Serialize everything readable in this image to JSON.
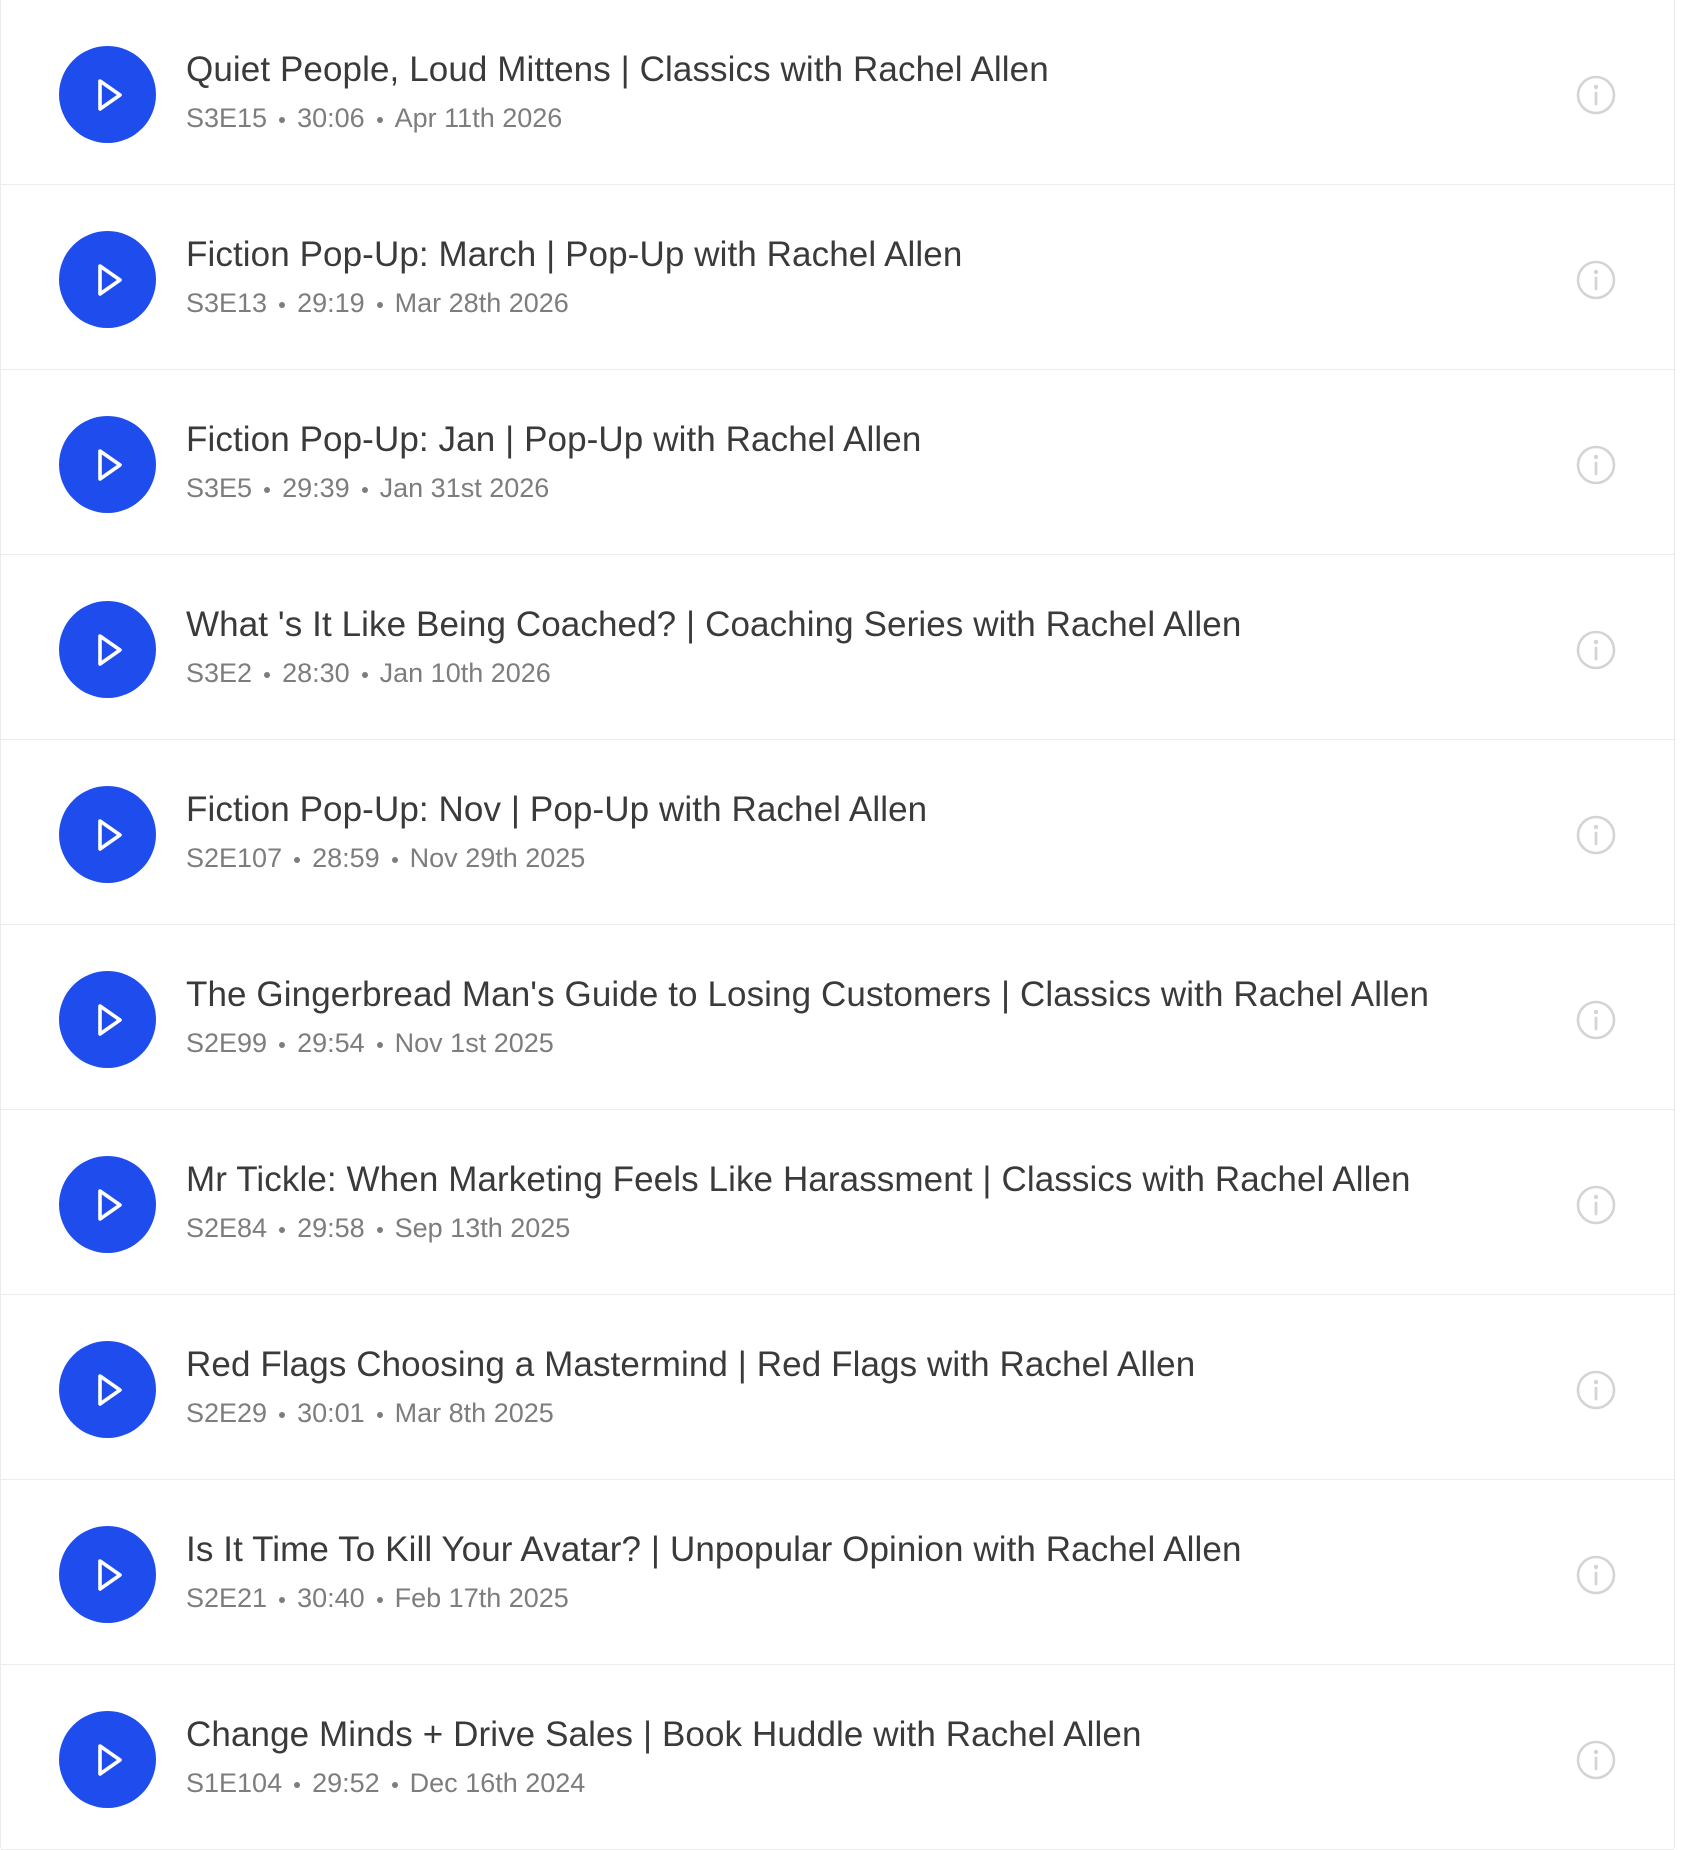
{
  "colors": {
    "play_button": "#1f4ded",
    "title_text": "#3a3a3a",
    "meta_text": "#7d7d7d",
    "info_icon": "#d4d4d4",
    "divider": "#ececec"
  },
  "episodes": [
    {
      "title": "Quiet People, Loud Mittens | Classics with Rachel Allen",
      "code": "S3E15",
      "duration": "30:06",
      "date": "Apr 11th 2026"
    },
    {
      "title": "Fiction Pop-Up: March | Pop-Up with Rachel Allen",
      "code": "S3E13",
      "duration": "29:19",
      "date": "Mar 28th 2026"
    },
    {
      "title": "Fiction Pop-Up: Jan | Pop-Up with Rachel Allen",
      "code": "S3E5",
      "duration": "29:39",
      "date": "Jan 31st 2026"
    },
    {
      "title": "What 's It Like Being Coached? | Coaching Series with Rachel Allen",
      "code": "S3E2",
      "duration": "28:30",
      "date": "Jan 10th 2026"
    },
    {
      "title": "Fiction Pop-Up: Nov | Pop-Up with Rachel Allen",
      "code": "S2E107",
      "duration": "28:59",
      "date": "Nov 29th 2025"
    },
    {
      "title": "The Gingerbread Man's Guide to Losing Customers | Classics with Rachel Allen",
      "code": "S2E99",
      "duration": "29:54",
      "date": "Nov 1st 2025"
    },
    {
      "title": "Mr Tickle: When Marketing Feels Like Harassment | Classics with Rachel Allen",
      "code": "S2E84",
      "duration": "29:58",
      "date": "Sep 13th 2025"
    },
    {
      "title": "Red Flags Choosing a Mastermind | Red Flags with Rachel Allen",
      "code": "S2E29",
      "duration": "30:01",
      "date": "Mar 8th 2025"
    },
    {
      "title": "Is It Time To Kill Your Avatar? | Unpopular Opinion with Rachel Allen",
      "code": "S2E21",
      "duration": "30:40",
      "date": "Feb 17th 2025"
    },
    {
      "title": "Change Minds + Drive Sales | Book Huddle with Rachel Allen",
      "code": "S1E104",
      "duration": "29:52",
      "date": "Dec 16th 2024"
    }
  ],
  "icons": {
    "play": "play-icon",
    "info": "info-icon"
  }
}
